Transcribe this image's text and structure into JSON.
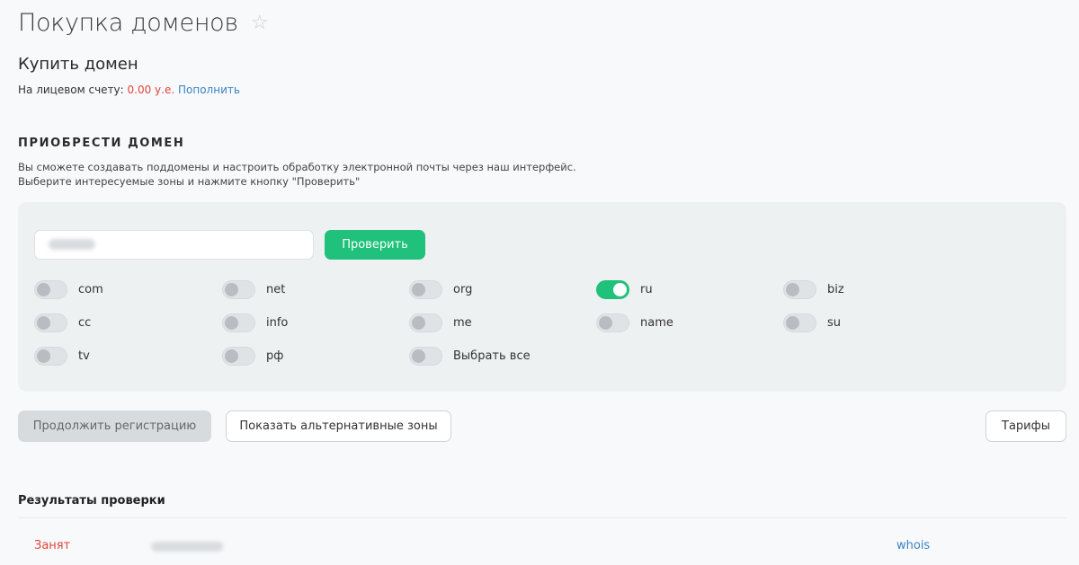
{
  "header": {
    "title": "Покупка доменов",
    "star_icon": "star-outline-icon"
  },
  "buy": {
    "title": "Купить домен",
    "balance_label": "На лицевом счету: ",
    "balance_amount": "0.00 у.е.",
    "topup_link": "Пополнить"
  },
  "acquire": {
    "heading": "ПРИОБРЕСТИ ДОМЕН",
    "desc_line1": "Вы сможете создавать поддомены и настроить обработку электронной почты через наш интерфейс.",
    "desc_line2": "Выберите интересуемые зоны и нажмите кнопку \"Проверить\"",
    "check_button": "Проверить",
    "zones": [
      {
        "label": "com",
        "checked": false
      },
      {
        "label": "net",
        "checked": false
      },
      {
        "label": "org",
        "checked": false
      },
      {
        "label": "ru",
        "checked": true
      },
      {
        "label": "biz",
        "checked": false
      },
      {
        "label": "cc",
        "checked": false
      },
      {
        "label": "info",
        "checked": false
      },
      {
        "label": "me",
        "checked": false
      },
      {
        "label": "name",
        "checked": false
      },
      {
        "label": "su",
        "checked": false
      },
      {
        "label": "tv",
        "checked": false
      },
      {
        "label": "рф",
        "checked": false
      },
      {
        "label": "Выбрать все",
        "checked": false
      }
    ]
  },
  "actions": {
    "continue": "Продолжить регистрацию",
    "alternative": "Показать альтернативные зоны",
    "tariffs": "Тарифы"
  },
  "results": {
    "title": "Результаты проверки",
    "rows": [
      {
        "status": "Занят",
        "whois": "whois"
      }
    ]
  },
  "colors": {
    "accent_green": "#1fc17b",
    "link_blue": "#3b82c4",
    "alert_red": "#e0443b"
  }
}
